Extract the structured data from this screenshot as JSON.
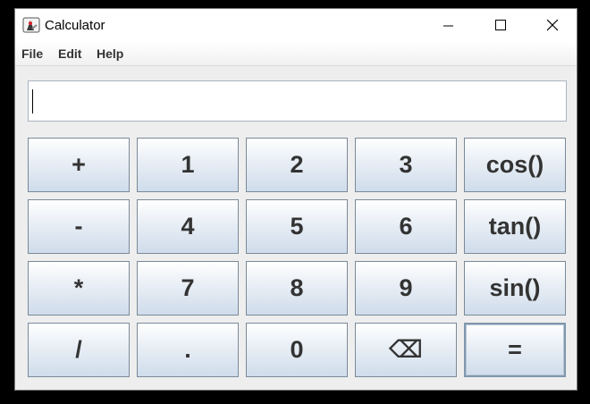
{
  "window": {
    "title": "Calculator",
    "app_icon": "java-duke-icon",
    "controls": {
      "minimize": "minimize-icon",
      "maximize": "maximize-icon",
      "close": "close-icon"
    }
  },
  "menu": {
    "items": [
      {
        "label": "File"
      },
      {
        "label": "Edit"
      },
      {
        "label": "Help"
      }
    ]
  },
  "display": {
    "value": ""
  },
  "keypad": {
    "keys": [
      {
        "label": "+",
        "name": "key-plus"
      },
      {
        "label": "1",
        "name": "key-1"
      },
      {
        "label": "2",
        "name": "key-2"
      },
      {
        "label": "3",
        "name": "key-3"
      },
      {
        "label": "cos()",
        "name": "key-cos"
      },
      {
        "label": "-",
        "name": "key-minus"
      },
      {
        "label": "4",
        "name": "key-4"
      },
      {
        "label": "5",
        "name": "key-5"
      },
      {
        "label": "6",
        "name": "key-6"
      },
      {
        "label": "tan()",
        "name": "key-tan"
      },
      {
        "label": "*",
        "name": "key-multiply"
      },
      {
        "label": "7",
        "name": "key-7"
      },
      {
        "label": "8",
        "name": "key-8"
      },
      {
        "label": "9",
        "name": "key-9"
      },
      {
        "label": "sin()",
        "name": "key-sin"
      },
      {
        "label": "/",
        "name": "key-divide"
      },
      {
        "label": ".",
        "name": "key-decimal"
      },
      {
        "label": "0",
        "name": "key-0"
      },
      {
        "label": "⌫",
        "name": "key-backspace"
      },
      {
        "label": "=",
        "name": "key-equals"
      }
    ]
  },
  "colors": {
    "button_gradient_top": "#ffffff",
    "button_gradient_bottom": "#cfdceb",
    "button_border": "#7a8a99",
    "button_text": "#333333",
    "window_background": "#eeeeee"
  }
}
